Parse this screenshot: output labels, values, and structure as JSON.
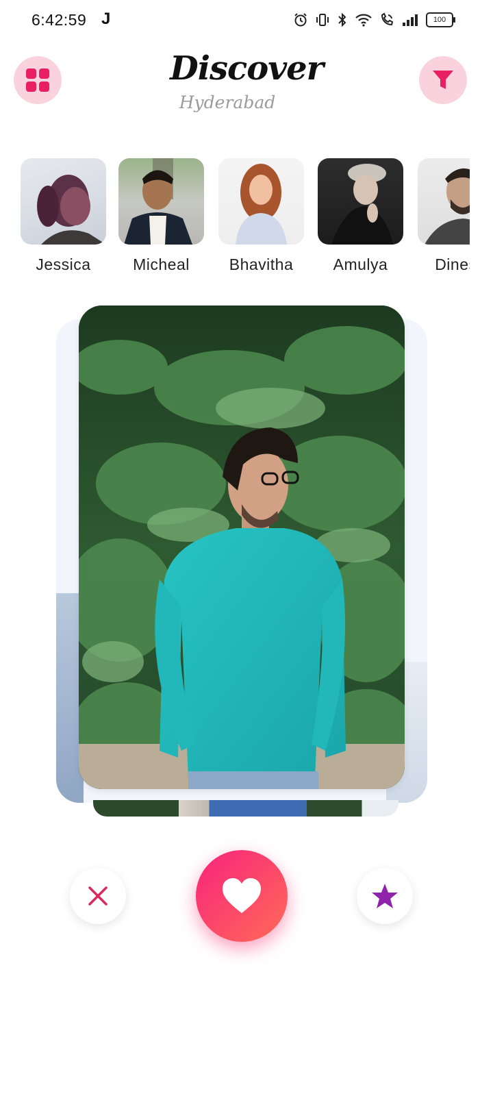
{
  "status_bar": {
    "time": "6:42:59",
    "app_indicator": "J",
    "battery": "100",
    "icons": [
      "alarm-icon",
      "vibrate-icon",
      "bluetooth-icon",
      "wifi-icon",
      "wifi-call-icon",
      "signal-icon",
      "battery-icon"
    ]
  },
  "header": {
    "title": "Discover",
    "location": "Hyderabad",
    "menu_icon": "grid-icon",
    "filter_icon": "filter-icon"
  },
  "stories": [
    {
      "name": "Jessica"
    },
    {
      "name": "Micheal"
    },
    {
      "name": "Bhavitha"
    },
    {
      "name": "Amulya"
    },
    {
      "name": "Dinesh"
    }
  ],
  "actions": {
    "dislike_icon": "close-icon",
    "like_icon": "heart-icon",
    "superlike_icon": "star-icon"
  },
  "colors": {
    "accent_pink": "#f0266f",
    "accent_soft": "#f9d2de",
    "like_gradient_start": "#f8237d",
    "like_gradient_end": "#ff6b57",
    "star_purple": "#8e24aa"
  }
}
